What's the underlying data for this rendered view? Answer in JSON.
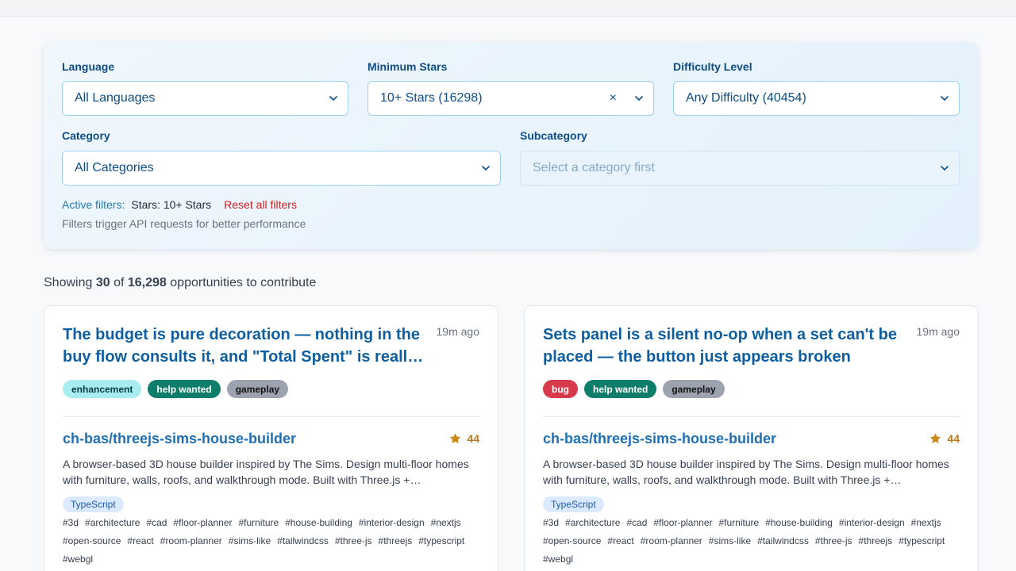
{
  "filters": {
    "language": {
      "label": "Language",
      "value": "All Languages"
    },
    "min_stars": {
      "label": "Minimum Stars",
      "value": "10+ Stars (16298)",
      "clear": "×"
    },
    "difficulty": {
      "label": "Difficulty Level",
      "value": "Any Difficulty (40454)"
    },
    "category": {
      "label": "Category",
      "value": "All Categories"
    },
    "subcategory": {
      "label": "Subcategory",
      "placeholder": "Select a category first"
    },
    "active_label": "Active filters:",
    "active_value": "Stars: 10+ Stars",
    "reset": "Reset all filters",
    "hint": "Filters trigger API requests for better performance"
  },
  "results": {
    "prefix": "Showing",
    "shown": "30",
    "of": "of",
    "total": "16,298",
    "suffix": "opportunities to contribute"
  },
  "cards": [
    {
      "title": "The budget is pure decoration — nothing in the buy flow consults it, and \"Total Spent\" is reall…",
      "time": "19m ago",
      "labels": [
        "enhancement",
        "help wanted",
        "gameplay"
      ],
      "repo": "ch-bas/threejs-sims-house-builder",
      "stars": "44",
      "description": "A browser-based 3D house builder inspired by The Sims. Design multi-floor homes with furniture, walls, roofs, and walkthrough mode. Built with Three.js +…",
      "language": "TypeScript",
      "topics": [
        "#3d",
        "#architecture",
        "#cad",
        "#floor-planner",
        "#furniture",
        "#house-building",
        "#interior-design",
        "#nextjs",
        "#open-source",
        "#react",
        "#room-planner",
        "#sims-like",
        "#tailwindcss",
        "#three-js",
        "#threejs",
        "#typescript",
        "#webgl"
      ]
    },
    {
      "title": "Sets panel is a silent no-op when a set can't be placed — the button just appears broken",
      "time": "19m ago",
      "labels": [
        "bug",
        "help wanted",
        "gameplay"
      ],
      "repo": "ch-bas/threejs-sims-house-builder",
      "stars": "44",
      "description": "A browser-based 3D house builder inspired by The Sims. Design multi-floor homes with furniture, walls, roofs, and walkthrough mode. Built with Three.js +…",
      "language": "TypeScript",
      "topics": [
        "#3d",
        "#architecture",
        "#cad",
        "#floor-planner",
        "#furniture",
        "#house-building",
        "#interior-design",
        "#nextjs",
        "#open-source",
        "#react",
        "#room-planner",
        "#sims-like",
        "#tailwindcss",
        "#three-js",
        "#threejs",
        "#typescript",
        "#webgl"
      ]
    }
  ],
  "colors": {
    "accent": "#0f5fa0",
    "star": "#c98a1a",
    "label_enhancement": "#a8ecf0",
    "label_help_wanted": "#0e7e6a",
    "label_gameplay": "#9ca3af",
    "label_bug": "#d73a4a"
  },
  "icons": {
    "dropdown": "chevron-down-icon",
    "star": "star-icon",
    "clear": "clear-icon"
  }
}
